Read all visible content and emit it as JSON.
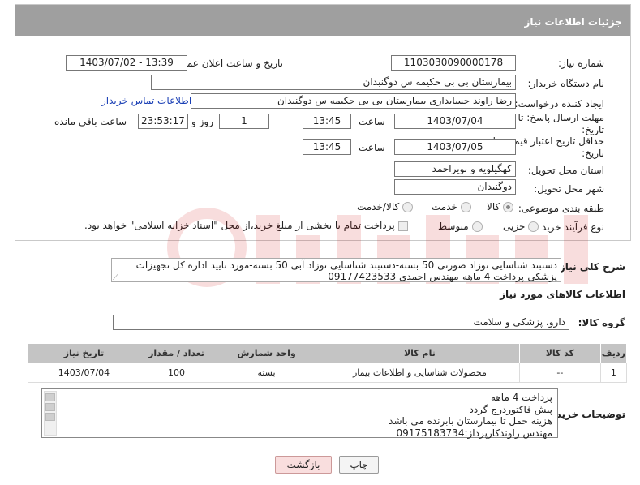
{
  "header": {
    "title": "جزئیات اطلاعات نیاز"
  },
  "fields": {
    "need_number_label": "شماره نیاز:",
    "need_number": "1103030090000178",
    "announce_label": "تاریخ و ساعت اعلان عمومی:",
    "announce_value": "1403/07/02 - 13:39",
    "buyer_org_label": "نام دستگاه خریدار:",
    "buyer_org": "بیمارستان بی بی حکیمه س  دوگنبدان",
    "creator_label": "ایجاد کننده درخواست:",
    "creator": "رضا راوند حسابداری بیمارستان بی بی حکیمه س  دوگنبدان",
    "contact_link": "اطلاعات تماس خریدار",
    "deadline_label": "مهلت ارسال پاسخ: تا تاریخ:",
    "deadline_date": "1403/07/04",
    "time_label": "ساعت",
    "deadline_time": "13:45",
    "days_value": "1",
    "days_label": "روز و",
    "remaining_time": "23:53:17",
    "remaining_label": "ساعت باقی مانده",
    "validity_label": "حداقل تاریخ اعتبار قیمت: تا تاریخ:",
    "validity_date": "1403/07/05",
    "validity_time": "13:45",
    "province_label": "استان محل تحویل:",
    "province": "کهگیلویه و بویراحمد",
    "city_label": "شهر محل تحویل:",
    "city": "دوگنبدان",
    "category_label": "طبقه بندی موضوعی:",
    "cat_goods": "کالا",
    "cat_service": "خدمت",
    "cat_both": "کالا/خدمت",
    "process_label": "نوع فرآیند خرید :",
    "proc_partial": "جزیی",
    "proc_medium": "متوسط",
    "payment_note": "پرداخت تمام یا بخشی از مبلغ خرید،از محل \"اسناد خزانه اسلامی\" خواهد بود."
  },
  "description": {
    "label": "شرح کلی نیاز:",
    "line1": "دستبند شناسایی نوزاد صورتی 50 بسته-دستبند شناسایی نوزاد آبی 50 بسته-مورد تایید اداره کل تجهیزات",
    "line2": "پزشکی-پرداخت 4 ماهه-مهندس احمدی 09177423533"
  },
  "goods_section": {
    "title": "اطلاعات کالاهای مورد نیاز",
    "group_label": "گروه کالا:",
    "group_value": "دارو، پزشکی و سلامت"
  },
  "table": {
    "headers": [
      "ردیف",
      "کد کالا",
      "نام کالا",
      "واحد شمارش",
      "تعداد / مقدار",
      "تاریخ نیاز"
    ],
    "rows": [
      [
        "1",
        "--",
        "محصولات شناسایی و اطلاعات بیمار",
        "بسته",
        "100",
        "1403/07/04"
      ]
    ]
  },
  "notes": {
    "label": "توضیحات خریدار:",
    "lines": [
      "پرداخت 4 ماهه",
      "پیش فاکتوردرج گردد",
      "هزینه حمل تا بیمارستان بابرنده می باشد",
      "مهندس راوندکارپرداز:09175183734"
    ]
  },
  "buttons": {
    "print": "چاپ",
    "back": "بازگشت"
  },
  "colors": {
    "header_bg": "#9f9f9f",
    "link": "#1a3fb5",
    "back_btn": "#f9dede"
  }
}
